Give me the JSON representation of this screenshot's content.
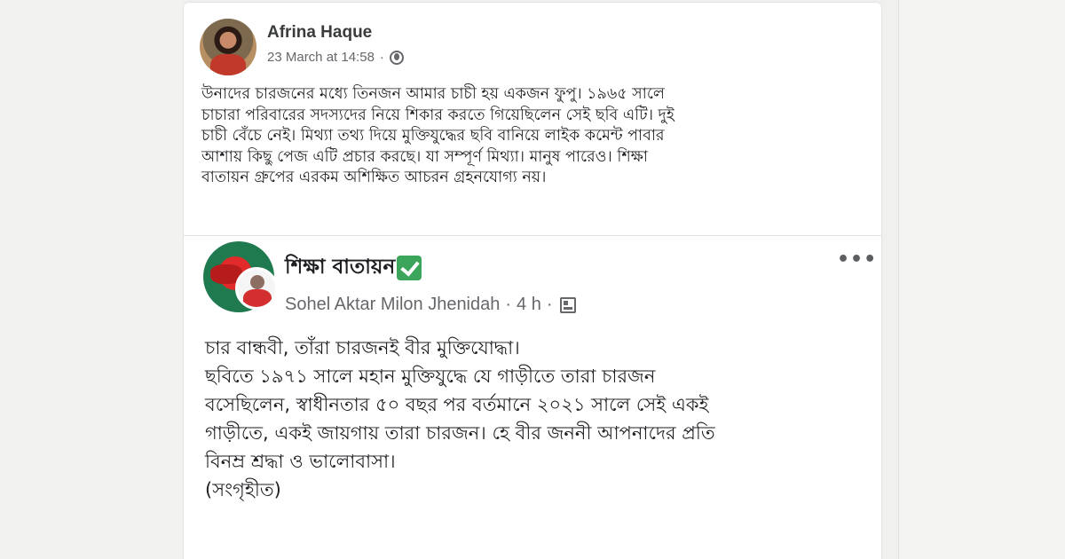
{
  "outer_post": {
    "author": "Afrina Haque",
    "timestamp": "23 March at 14:58",
    "separator": "·",
    "privacy_icon": "globe-icon",
    "text_lines": [
      "উনাদের চারজনের মধ্যে তিনজন আমার চাচী হয় একজন ফুপু। ১৯৬৫ সালে",
      "চাচারা পরিবারের সদস্যদের নিয়ে শিকার করতে গিয়েছিলেন সেই ছবি এটি। দুই",
      "চাচী বেঁচে নেই। মিথ্যা তথ্য দিয়ে মুক্তিযুদ্ধের ছবি বানিয়ে লাইক কমেন্ট পাবার",
      "আশায় কিছু পেজ এটি প্রচার করছে। যা সম্পূর্ণ মিথ্যা। মানুষ পারেও। শিক্ষা",
      "বাতায়ন গ্রুপের এরকম অশিক্ষিত আচরন গ্রহনযোগ্য নয়।"
    ]
  },
  "shared_post": {
    "page_name": "শিক্ষা বাতায়ন",
    "verified_icon": "check-mark-icon",
    "more_label": "•••",
    "poster": "Sohel Aktar Milon Jhenidah",
    "sep1": "·",
    "time_ago": "4 h",
    "sep2": "·",
    "audience_icon": "group-icon",
    "text_lines": [
      "চার বান্ধবী, তাঁরা চারজনই বীর মুক্তিযোদ্ধা।",
      "ছবিতে ১৯৭১ সালে মহান মুক্তিযুদ্ধে যে গাড়ীতে তারা চারজন",
      "বসেছিলেন, স্বাধীনতার ৫০ বছর পর বর্তমানে ২০২১ সালে সেই একই",
      "গাড়ীতে, একই জায়গায় তারা চারজন। হে বীর জননী আপনাদের প্রতি",
      "বিনম্র শ্রদ্ধা ও ভালোবাসা।",
      " (সংগৃহীত)"
    ]
  }
}
